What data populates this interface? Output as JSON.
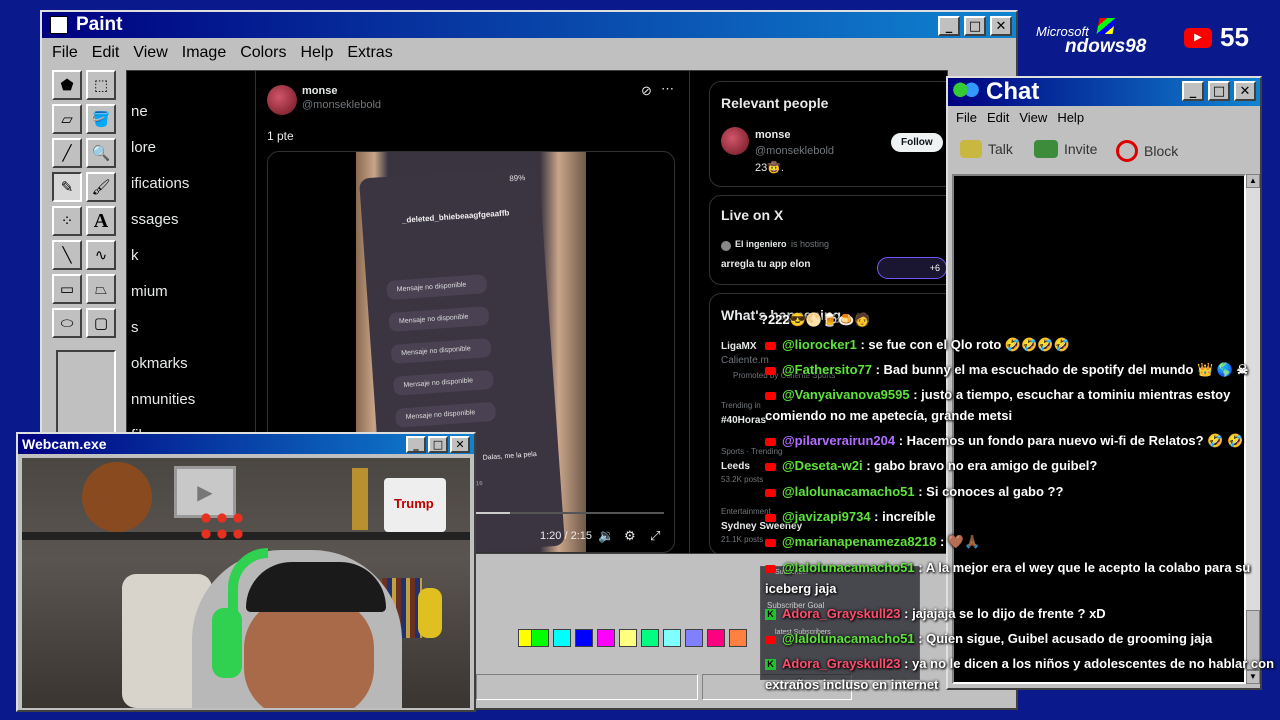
{
  "desktop": {
    "logo_microsoft": "Microsoft",
    "logo_windows": "ndows98",
    "yt_count": "55"
  },
  "paint": {
    "title": "Paint",
    "menu": [
      "File",
      "Edit",
      "View",
      "Image",
      "Colors",
      "Help",
      "Extras"
    ],
    "tools": [
      "free-select",
      "rect-select",
      "eraser",
      "fill",
      "eyedropper",
      "zoom",
      "pencil",
      "brush",
      "airbrush",
      "text",
      "line",
      "curve",
      "rectangle",
      "polygon",
      "ellipse",
      "rounded-rect"
    ],
    "palette": [
      "#ffff00",
      "#00ff00",
      "#00ffff",
      "#0000ff",
      "#ff00ff",
      "#ffff80",
      "#00ff80",
      "#80ffff",
      "#8080ff",
      "#ff0080",
      "#ff8040"
    ]
  },
  "x": {
    "nav": [
      "ne",
      "lore",
      "ifications",
      "ssages",
      "k",
      "mium",
      "s",
      "okmarks",
      "nmunities",
      "file"
    ],
    "post": {
      "name": "monse",
      "handle": "@monseklebold",
      "text": "1 pte",
      "video_time": "1:20 / 2:15"
    },
    "phone": {
      "header": "_deleted_bhiebeaagfgeaaffb",
      "battery": "89%",
      "messages": [
        "Mensaje no disponible",
        "Mensaje no disponible",
        "Mensaje no disponible",
        "Mensaje no disponible",
        "Mensaje no disponible"
      ],
      "reply": "Dalas, me la pela",
      "date": "15 abr 2016",
      "tail1": "jajajaja xd",
      "tail2": "estás nudes?"
    },
    "relevant": {
      "title": "Relevant people",
      "name": "monse",
      "handle": "@monseklebold",
      "bio": "23🤠.",
      "follow": "Follow"
    },
    "live": {
      "title": "Live on X",
      "host": "El ingeniero",
      "hosting": "is hosting",
      "topic": "arregla tu app elon",
      "count": "+6"
    },
    "happening": {
      "title": "What's happening",
      "items": [
        {
          "meta": "",
          "name": "LigaMX",
          "sub": "Caliente.m"
        },
        {
          "meta": "Promoted by Caliente Sports",
          "name": "",
          "sub": ""
        },
        {
          "meta": "Trending in",
          "name": "#40Horas",
          "sub": ""
        },
        {
          "meta": "Sports · Trending",
          "name": "Leeds",
          "sub": "53.2K posts"
        },
        {
          "meta": "Entertainment",
          "name": "Sydney Sweeney",
          "sub": "21.1K posts"
        }
      ]
    }
  },
  "chat": {
    "title": "Chat",
    "menu": [
      "File",
      "Edit",
      "View",
      "Help"
    ],
    "toolbar": [
      "Talk",
      "Invite",
      "Block"
    ],
    "header_emojis": "?222😎🌕🍺🍮🧑",
    "messages": [
      {
        "platform": "yt",
        "user": "@liorocker1",
        "color": "u-green",
        "text": " : se fue con el Qlo roto 🤣🤣🤣🤣"
      },
      {
        "platform": "yt",
        "user": "@Fathersito77",
        "color": "u-green",
        "text": " : Bad bunny el ma escuchado de spotify del mundo 👑 🌎 ☠"
      },
      {
        "platform": "yt",
        "user": "@Vanyaivanova9595",
        "color": "u-green",
        "text": " : justo a tiempo, escuchar a tominiu mientras estoy"
      },
      {
        "platform": "",
        "user": "",
        "color": "",
        "text": "comiendo no me apetecía, grande metsi"
      },
      {
        "platform": "yt",
        "user": "@pilarverairun204",
        "color": "u-purple",
        "text": " : Hacemos un fondo para nuevo wi-fi de Relatos? 🤣 🤣"
      },
      {
        "platform": "yt",
        "user": "@Deseta-w2i",
        "color": "u-green",
        "text": " : gabo bravo no era amigo de guibel?"
      },
      {
        "platform": "yt",
        "user": "@lalolunacamacho51",
        "color": "u-green",
        "text": " : Si conoces al gabo ??"
      },
      {
        "platform": "yt",
        "user": "@javizapi9734",
        "color": "u-green",
        "text": " : increíble"
      },
      {
        "platform": "yt",
        "user": "@marianapenameza8218",
        "color": "u-green",
        "text": " : 🤎🙏🏾"
      },
      {
        "platform": "yt",
        "user": "@lalolunacamacho51",
        "color": "u-green",
        "text": " : A la mejor era el wey que le acepto la colabo para su"
      },
      {
        "platform": "",
        "user": "",
        "color": "",
        "text": "iceberg jaja"
      },
      {
        "platform": "kick",
        "user": "Adora_Grayskull23",
        "color": "u-red",
        "text": " : jajajaja se lo dijo de frente ? xD"
      },
      {
        "platform": "yt",
        "user": "@lalolunacamacho51",
        "color": "u-green",
        "text": " : Quien sigue, Guibel acusado de grooming jaja"
      },
      {
        "platform": "kick",
        "user": "Adora_Grayskull23",
        "color": "u-red",
        "text": " : ya no le dicen a los niños y adolescentes de no hablar con"
      },
      {
        "platform": "",
        "user": "",
        "color": "",
        "text": "extraños incluso en internet"
      }
    ]
  },
  "webcam": {
    "title": "Webcam.exe",
    "sign_top": "Trump"
  },
  "overlay": {
    "subscriber": "Subscriber",
    "goal": "Subscriber Goal",
    "subs": "latest Subscribers"
  }
}
